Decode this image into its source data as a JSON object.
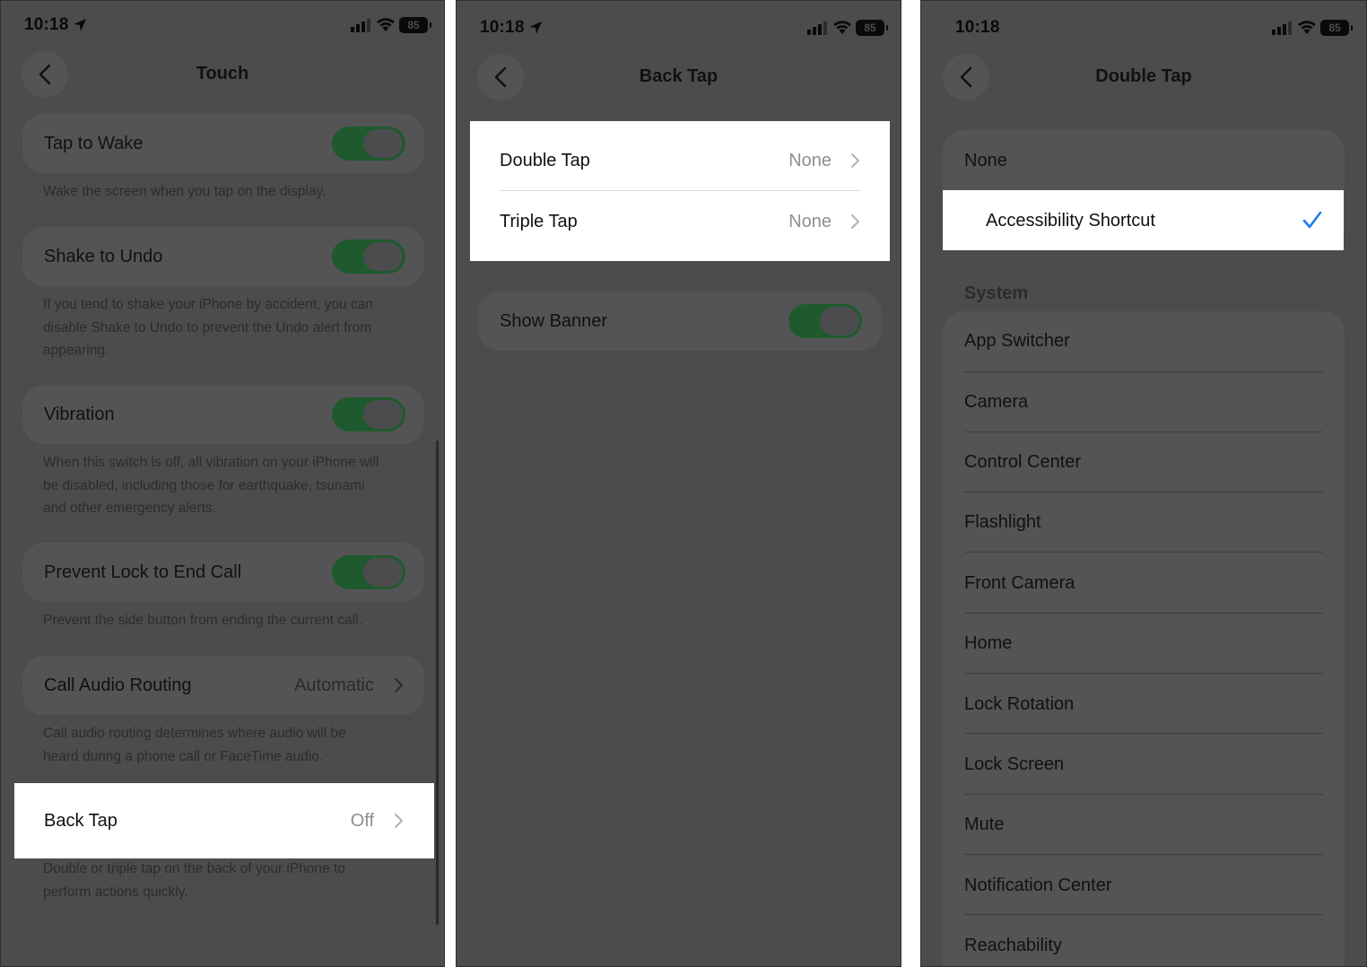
{
  "status": {
    "time": "10:18",
    "battery": "85"
  },
  "screen1": {
    "title": "Touch",
    "rows": {
      "tap_to_wake": {
        "label": "Tap to Wake",
        "on": true,
        "footer": "Wake the screen when you tap on the display."
      },
      "shake_to_undo": {
        "label": "Shake to Undo",
        "on": true,
        "footer_lines": [
          "If you tend to shake your iPhone by accident, you can",
          "disable Shake to Undo to prevent the Undo alert from",
          "appearing."
        ]
      },
      "vibration": {
        "label": "Vibration",
        "on": true,
        "footer_lines": [
          "When this switch is off, all vibration on your iPhone will",
          "be disabled, including those for earthquake, tsunami",
          "and other emergency alerts."
        ]
      },
      "prevent_lock": {
        "label": "Prevent Lock to End Call",
        "on": true,
        "footer": "Prevent the side button from ending the current call."
      },
      "call_audio": {
        "label": "Call Audio Routing",
        "value": "Automatic",
        "footer_lines": [
          "Call audio routing determines where audio will be",
          "heard during a phone call or FaceTime audio."
        ]
      },
      "back_tap": {
        "label": "Back Tap",
        "value": "Off",
        "footer_lines": [
          "Double or triple tap on the back of your iPhone to",
          "perform actions quickly."
        ]
      }
    }
  },
  "screen2": {
    "title": "Back Tap",
    "double_tap": {
      "label": "Double Tap",
      "value": "None"
    },
    "triple_tap": {
      "label": "Triple Tap",
      "value": "None"
    },
    "show_banner": {
      "label": "Show Banner",
      "on": true
    }
  },
  "screen3": {
    "title": "Double Tap",
    "none_label": "None",
    "accessibility_shortcut": "Accessibility Shortcut",
    "system_header": "System",
    "system_items": [
      "App Switcher",
      "Camera",
      "Control Center",
      "Flashlight",
      "Front Camera",
      "Home",
      "Lock Rotation",
      "Lock Screen",
      "Mute",
      "Notification Center",
      "Reachability"
    ]
  },
  "colors": {
    "dim_bg": "#4c4c4e",
    "toggle_on": "#1f5a2e",
    "checkmark": "#1a7cf5"
  },
  "icons": [
    "location-arrow-icon",
    "cellular-signal-icon",
    "wifi-icon",
    "battery-icon",
    "back-chevron-icon",
    "disclosure-chevron-icon",
    "checkmark-icon"
  ]
}
